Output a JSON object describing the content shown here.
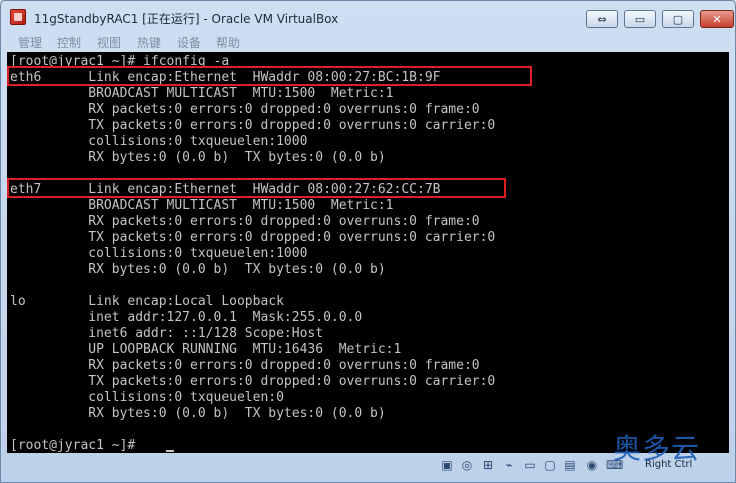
{
  "window": {
    "title": "11gStandbyRAC1 [正在运行] - Oracle VM VirtualBox",
    "buttons": {
      "restore": "⇔",
      "minimize": "▭",
      "maximize": "▢",
      "close": "✕"
    }
  },
  "menubar": {
    "items": [
      "管理",
      "控制",
      "视图",
      "热键",
      "设备",
      "帮助"
    ]
  },
  "console": {
    "lines": [
      "[root@jyrac1 ~]# ifconfig -a",
      "eth6      Link encap:Ethernet  HWaddr 08:00:27:BC:1B:9F",
      "          BROADCAST MULTICAST  MTU:1500  Metric:1",
      "          RX packets:0 errors:0 dropped:0 overruns:0 frame:0",
      "          TX packets:0 errors:0 dropped:0 overruns:0 carrier:0",
      "          collisions:0 txqueuelen:1000",
      "          RX bytes:0 (0.0 b)  TX bytes:0 (0.0 b)",
      "",
      "eth7      Link encap:Ethernet  HWaddr 08:00:27:62:CC:7B",
      "          BROADCAST MULTICAST  MTU:1500  Metric:1",
      "          RX packets:0 errors:0 dropped:0 overruns:0 frame:0",
      "          TX packets:0 errors:0 dropped:0 overruns:0 carrier:0",
      "          collisions:0 txqueuelen:1000",
      "          RX bytes:0 (0.0 b)  TX bytes:0 (0.0 b)",
      "",
      "lo        Link encap:Local Loopback",
      "          inet addr:127.0.0.1  Mask:255.0.0.0",
      "          inet6 addr: ::1/128 Scope:Host",
      "          UP LOOPBACK RUNNING  MTU:16436  Metric:1",
      "          RX packets:0 errors:0 dropped:0 overruns:0 frame:0",
      "          TX packets:0 errors:0 dropped:0 overruns:0 carrier:0",
      "          collisions:0 txqueuelen:0",
      "          RX bytes:0 (0.0 b)  TX bytes:0 (0.0 b)",
      "",
      "[root@jyrac1 ~]# "
    ],
    "text_color": "#c4c4c4",
    "background": "#000000",
    "highlight_color": "#e02020"
  },
  "statusbar": {
    "icons": [
      "hard-disk-icon",
      "optical-drive-icon",
      "network-icon",
      "usb-icon",
      "shared-folder-icon",
      "display-icon",
      "capture-icon",
      "mouse-integration-icon",
      "keyboard-icon"
    ],
    "host_key": "Right Ctrl"
  },
  "watermark": {
    "text": "奥多云"
  }
}
